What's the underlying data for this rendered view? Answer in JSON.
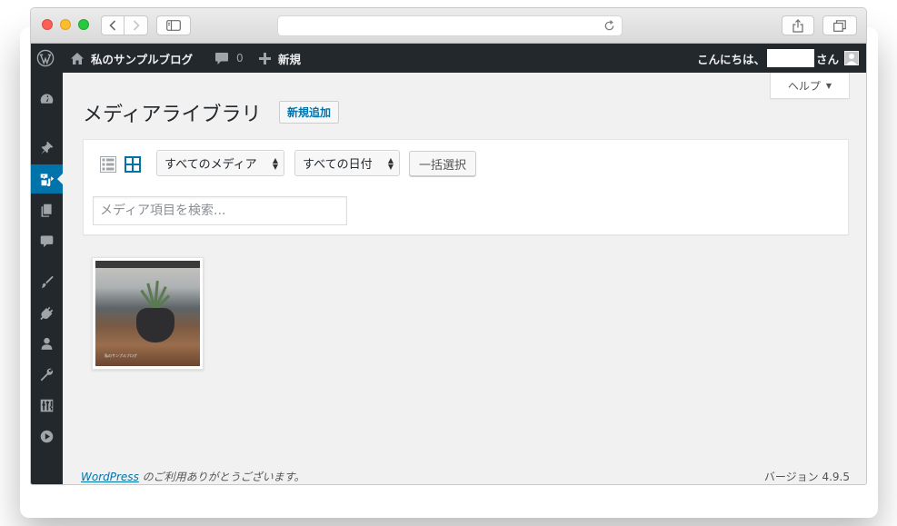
{
  "adminbar": {
    "site_name": "私のサンプルブログ",
    "comments_count": "0",
    "new_label": "新規",
    "greeting_prefix": "こんにちは、",
    "greeting_suffix": "さん"
  },
  "help": {
    "label": "ヘルプ",
    "arrow": "▼"
  },
  "page": {
    "title": "メディアライブラリ",
    "add_new_label": "新規追加"
  },
  "toolbar": {
    "type_filter": "すべてのメディア",
    "date_filter": "すべての日付",
    "bulk_select_label": "一括選択",
    "search_placeholder": "メディア項目を検索..."
  },
  "media": {
    "items": [
      {
        "caption": "私のサンプルブログ"
      }
    ]
  },
  "footer": {
    "wp_link": "WordPress",
    "thanks": " のご利用ありがとうございます。",
    "version": "バージョン 4.9.5"
  },
  "colors": {
    "adminbar_bg": "#23282d",
    "accent": "#0073aa",
    "content_bg": "#f1f1f1"
  }
}
